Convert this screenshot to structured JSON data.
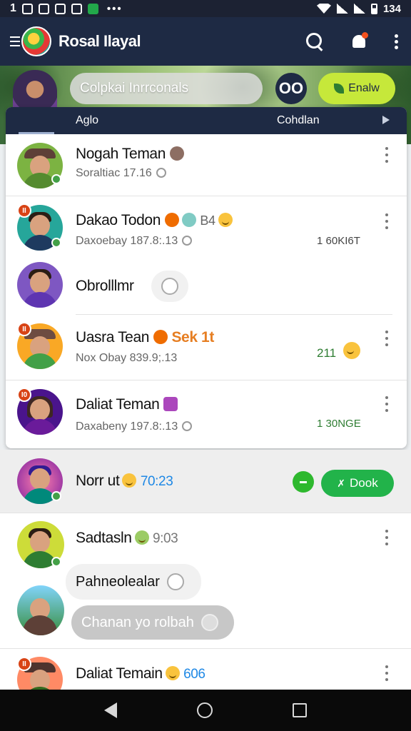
{
  "status_bar": {
    "icons": [
      "notification-1",
      "notification-0",
      "app-icon",
      "doc-icon",
      "green-app-icon"
    ],
    "time": "134",
    "overflow": "•••"
  },
  "app_bar": {
    "title": "Rosal Ilayal"
  },
  "banner": {
    "search_placeholder": "Colpkai Inrrconals",
    "infinity_label": "OO",
    "enable_label": "Enalw"
  },
  "tabs": [
    {
      "label": "Aglo"
    },
    {
      "label": "Cohdlan"
    }
  ],
  "card_items": [
    {
      "name": "Nogah Teman",
      "sub": "Soraltiac 17.16"
    },
    {
      "name": "Dakao Todon",
      "name_extra": "B4",
      "sub": "Daxoebay 187.8:.13",
      "meta": "1 60KI6T"
    },
    {
      "name": "Obrolllmr"
    },
    {
      "name": "Uasra Tean",
      "name_extra": "Sek 1t",
      "sub": "Nox Obay 839.9;.13",
      "meta": "211"
    },
    {
      "name": "Daliat Teman",
      "sub": "Daxabeny 197.8:.13",
      "meta": "1 30NGE"
    }
  ],
  "lower_items": [
    {
      "name": "Norr ut",
      "time": "70:23",
      "button": "Dook"
    },
    {
      "name": "Sadtasln",
      "time": "9:03"
    },
    {
      "bubble_1": "Pahneolealar",
      "bubble_2": "Chanan yo rolbah"
    },
    {
      "name": "Daliat Temain",
      "time": "606"
    }
  ],
  "colors": {
    "primary_dark": "#1e2a44",
    "accent_lime": "#c6e83a",
    "accent_green": "#22b34a",
    "meta_green": "#2e7d32"
  }
}
